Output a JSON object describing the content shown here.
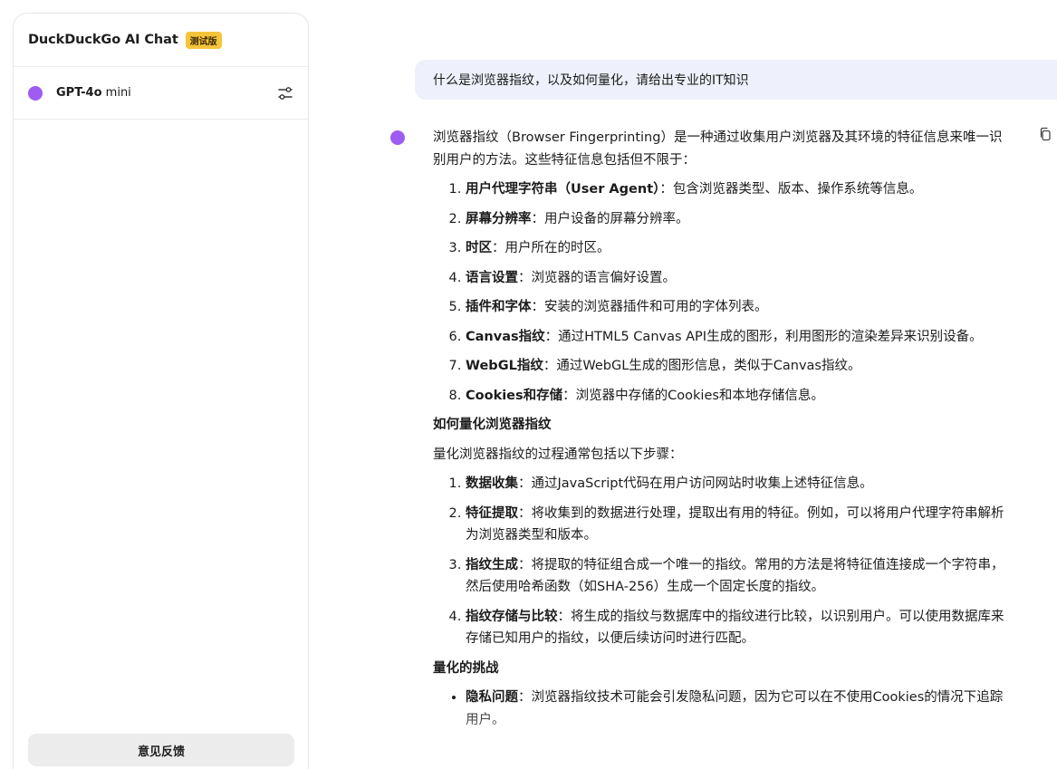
{
  "sidebar": {
    "app_title": "DuckDuckGo AI Chat",
    "beta_badge": "测试版",
    "model": {
      "name_bold": "GPT-4o",
      "name_suffix": " mini",
      "dot_color": "#9e5cf2",
      "settings_icon": "sliders-icon"
    },
    "feedback_label": "意见反馈"
  },
  "chat": {
    "user_message": "什么是浏览器指纹，以及如何量化，请给出专业的IT知识",
    "assistant": {
      "copy_icon": "copy-icon",
      "intro": "浏览器指纹（Browser Fingerprinting）是一种通过收集用户浏览器及其环境的特征信息来唯一识别用户的方法。这些特征信息包括但不限于：",
      "features": [
        {
          "term": "用户代理字符串（User Agent）",
          "desc": "：包含浏览器类型、版本、操作系统等信息。"
        },
        {
          "term": "屏幕分辨率",
          "desc": "：用户设备的屏幕分辨率。"
        },
        {
          "term": "时区",
          "desc": "：用户所在的时区。"
        },
        {
          "term": "语言设置",
          "desc": "：浏览器的语言偏好设置。"
        },
        {
          "term": "插件和字体",
          "desc": "：安装的浏览器插件和可用的字体列表。"
        },
        {
          "term": "Canvas指纹",
          "desc": "：通过HTML5 Canvas API生成的图形，利用图形的渲染差异来识别设备。"
        },
        {
          "term": "WebGL指纹",
          "desc": "：通过WebGL生成的图形信息，类似于Canvas指纹。"
        },
        {
          "term": "Cookies和存储",
          "desc": "：浏览器中存储的Cookies和本地存储信息。"
        }
      ],
      "heading_quantify": "如何量化浏览器指纹",
      "quantify_intro": "量化浏览器指纹的过程通常包括以下步骤：",
      "steps": [
        {
          "term": "数据收集",
          "desc": "：通过JavaScript代码在用户访问网站时收集上述特征信息。"
        },
        {
          "term": "特征提取",
          "desc": "：将收集到的数据进行处理，提取出有用的特征。例如，可以将用户代理字符串解析为浏览器类型和版本。"
        },
        {
          "term": "指纹生成",
          "desc": "：将提取的特征组合成一个唯一的指纹。常用的方法是将特征值连接成一个字符串，然后使用哈希函数（如SHA-256）生成一个固定长度的指纹。"
        },
        {
          "term": "指纹存储与比较",
          "desc": "：将生成的指纹与数据库中的指纹进行比较，以识别用户。可以使用数据库来存储已知用户的指纹，以便后续访问时进行匹配。"
        }
      ],
      "heading_challenges": "量化的挑战",
      "challenges": [
        {
          "term": "隐私问题",
          "desc": "：浏览器指纹技术可能会引发隐私问题，因为它可以在不使用Cookies的情况下追踪用户。"
        }
      ]
    }
  }
}
